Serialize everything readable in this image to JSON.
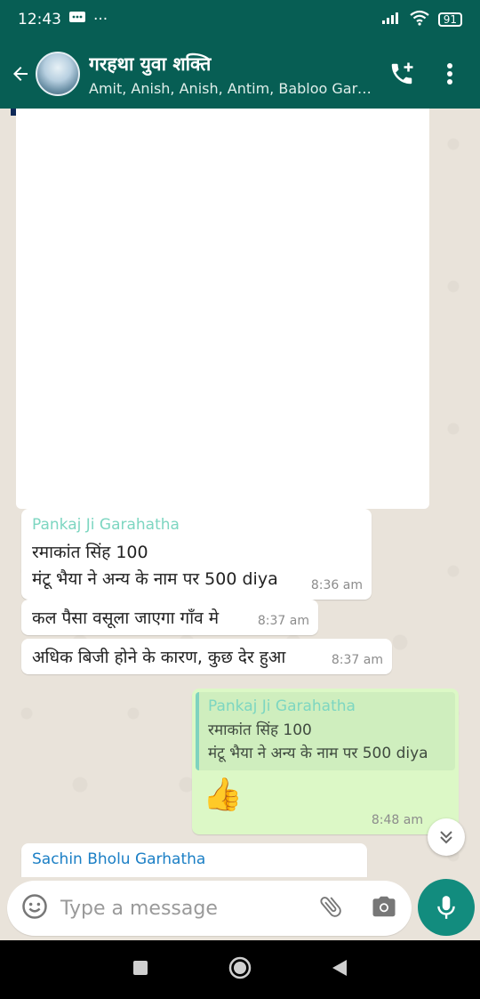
{
  "status": {
    "time": "12:43",
    "battery": "91"
  },
  "header": {
    "title": "गरहथा युवा शक्ति",
    "subtitle": "Amit, Anish, Anish, Antim, Babloo Garh..."
  },
  "messages": {
    "m1": {
      "sender": "Pankaj Ji Garahatha",
      "line1": "रमाकांत सिंह 100",
      "line2": "मंटू भैया ने अन्य के नाम पर 500 diya",
      "time": "8:36 am"
    },
    "m2": {
      "text": "कल पैसा वसूला जाएगा गाँव मे",
      "time": "8:37 am"
    },
    "m3": {
      "text": "अधिक बिजी होने के कारण, कुछ देर हुआ",
      "time": "8:37 am"
    },
    "m4": {
      "quote_sender": "Pankaj Ji Garahatha",
      "quote_line1": "रमाकांत सिंह 100",
      "quote_line2": "मंटू भैया ने अन्य के नाम पर 500 diya",
      "emoji": "👍",
      "time": "8:48 am"
    },
    "m5": {
      "sender": "Sachin Bholu Garhatha"
    }
  },
  "input": {
    "placeholder": "Type a message"
  },
  "colors": {
    "header": "#075e54",
    "accent": "#128c7e",
    "outgoing": "#dcf8c6"
  }
}
